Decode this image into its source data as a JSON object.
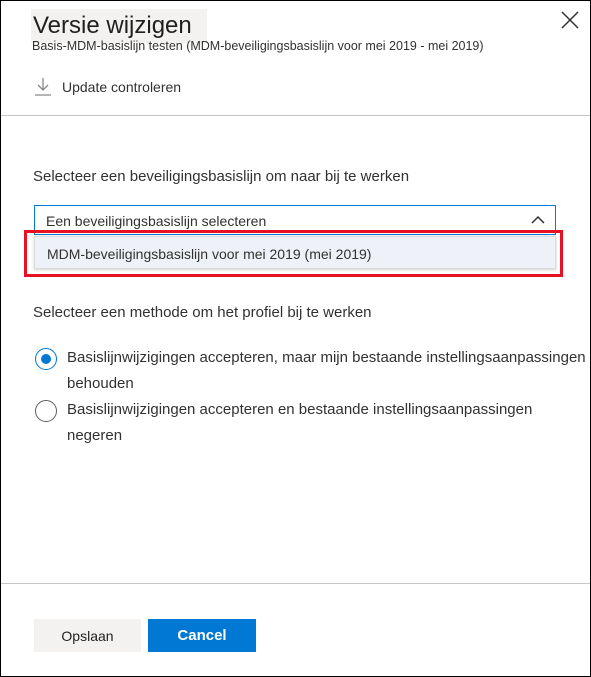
{
  "panel": {
    "title": "Versie wijzigen",
    "subtitle": "Basis-MDM-basislijn testen (MDM-beveiligingsbasislijn voor mei 2019 - mei 2019)"
  },
  "commands": {
    "update_check_label": "Update controleren"
  },
  "baseline_section": {
    "label": "Selecteer een beveiligingsbasislijn om naar bij te werken",
    "select_placeholder": "Een beveiligingsbasislijn selecteren",
    "options": [
      {
        "label": "MDM-beveiligingsbasislijn voor mei 2019 (mei 2019)"
      }
    ]
  },
  "method_section": {
    "label": "Selecteer een methode om het profiel bij te werken",
    "options": [
      {
        "label": "Basislijnwijzigingen accepteren, maar mijn bestaande instellingsaanpassingen behouden",
        "checked": true
      },
      {
        "label": "Basislijnwijzigingen accepteren en bestaande instellingsaanpassingen negeren",
        "checked": false
      }
    ]
  },
  "footer": {
    "save_label": "Opslaan",
    "cancel_label": "Cancel"
  },
  "colors": {
    "accent": "#0078d4",
    "highlight": "#e81123"
  }
}
